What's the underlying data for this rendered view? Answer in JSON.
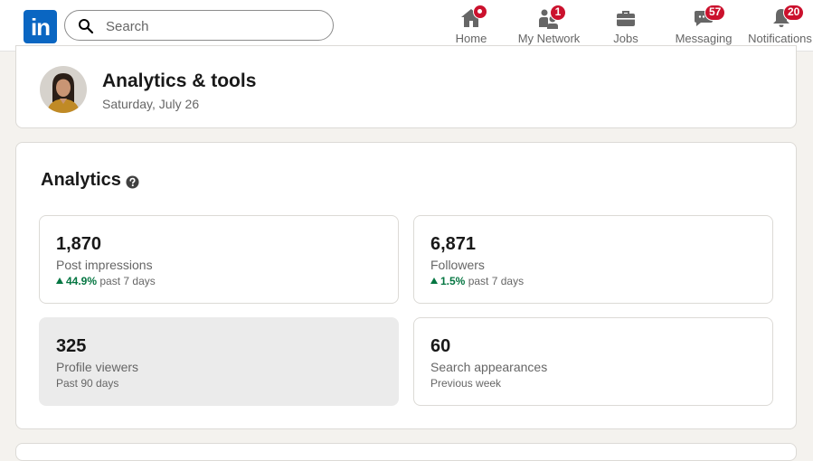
{
  "nav": {
    "logo_text": "in",
    "search_placeholder": "Search",
    "items": [
      {
        "label": "Home",
        "icon": "home-icon",
        "badge": ""
      },
      {
        "label": "My Network",
        "icon": "people-icon",
        "badge": "1"
      },
      {
        "label": "Jobs",
        "icon": "briefcase-icon",
        "badge": ""
      },
      {
        "label": "Messaging",
        "icon": "message-icon",
        "badge": "57"
      },
      {
        "label": "Notifications",
        "icon": "bell-icon",
        "badge": "20"
      }
    ]
  },
  "header": {
    "title": "Analytics & tools",
    "date": "Saturday, July 26"
  },
  "analytics": {
    "title": "Analytics",
    "metrics": [
      {
        "value": "1,870",
        "label": "Post impressions",
        "change": "44.9%",
        "period": "past 7 days"
      },
      {
        "value": "6,871",
        "label": "Followers",
        "change": "1.5%",
        "period": "past 7 days"
      },
      {
        "value": "325",
        "label": "Profile viewers",
        "period": "Past 90 days"
      },
      {
        "value": "60",
        "label": "Search appearances",
        "period": "Previous week"
      }
    ]
  },
  "colors": {
    "brand": "#0a66c2",
    "badge": "#cb112d",
    "positive": "#057642"
  }
}
